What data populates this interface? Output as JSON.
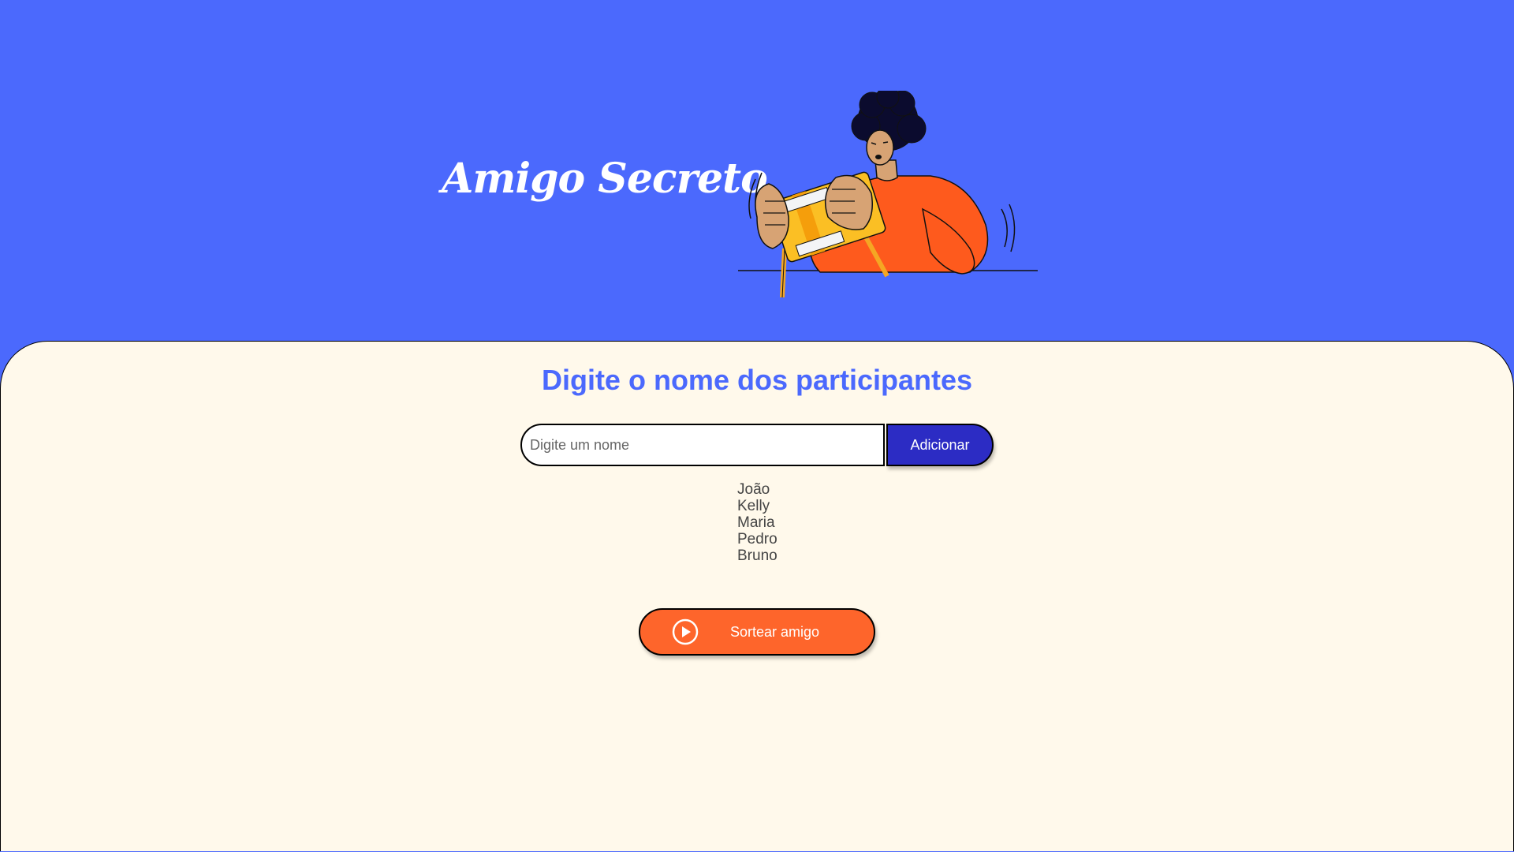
{
  "header": {
    "title": "Amigo Secreto",
    "illustration_icon": "person-opening-gift-box-illustration"
  },
  "main": {
    "subtitle": "Digite o nome dos participantes",
    "input": {
      "placeholder": "Digite um nome",
      "value": ""
    },
    "add_button_label": "Adicionar",
    "participants": [
      "João",
      "Kelly",
      "Maria",
      "Pedro",
      "Bruno"
    ],
    "draw_button": {
      "label": "Sortear amigo",
      "icon": "play-circle-icon"
    }
  },
  "colors": {
    "header_bg": "#4B69FD",
    "panel_bg": "#FFF9EB",
    "add_button_bg": "#2C2CC4",
    "draw_button_bg": "#FE652B",
    "subtitle_color": "#4B69FD"
  }
}
